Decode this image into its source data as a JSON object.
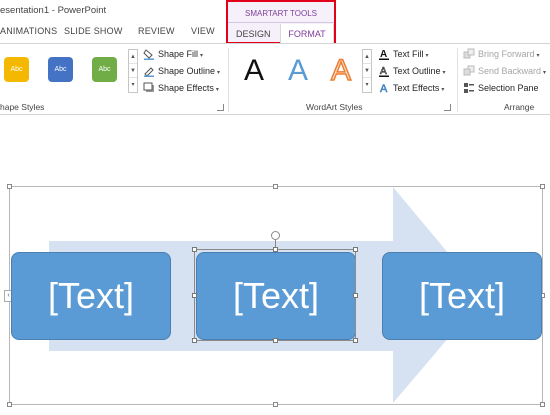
{
  "window": {
    "title": "esentation1 - PowerPoint"
  },
  "tabs": {
    "animations": "ANIMATIONS",
    "slide_show": "SLIDE SHOW",
    "review": "REVIEW",
    "view": "VIEW"
  },
  "contextual": {
    "group_title": "SMARTART TOOLS",
    "design": "DESIGN",
    "format": "FORMAT",
    "highlight_color": "#e2001a"
  },
  "ribbon": {
    "shape_styles": {
      "label": "hape Styles",
      "swatches": [
        {
          "text": "Abc",
          "color": "#f5b800"
        },
        {
          "text": "Abc",
          "color": "#4472c4"
        },
        {
          "text": "Abc",
          "color": "#70ad47"
        }
      ],
      "shape_fill": "Shape Fill",
      "shape_outline": "Shape Outline",
      "shape_effects": "Shape Effects"
    },
    "wordart_styles": {
      "label": "WordArt Styles",
      "samples": [
        {
          "letter": "A",
          "style": "black"
        },
        {
          "letter": "A",
          "style": "blue-gradient"
        },
        {
          "letter": "A",
          "style": "orange-outline"
        }
      ],
      "text_fill": "Text Fill",
      "text_outline": "Text Outline",
      "text_effects": "Text Effects"
    },
    "arrange": {
      "label": "Arrange",
      "bring_forward": "Bring Forward",
      "send_backward": "Send Backward",
      "selection_pane": "Selection Pane"
    }
  },
  "smartart": {
    "nodes": [
      "[Text]",
      "[Text]",
      "[Text]"
    ],
    "node_color": "#5b9bd5",
    "arrow_color": "#d6e1f1"
  }
}
